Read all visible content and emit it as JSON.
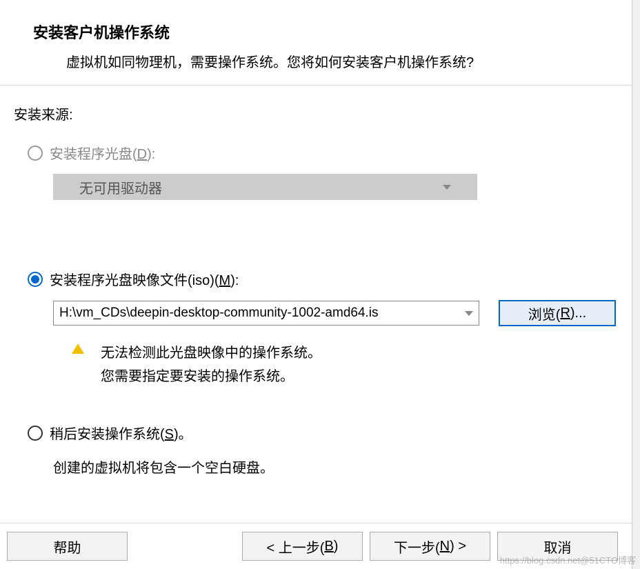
{
  "header": {
    "title": "安装客户机操作系统",
    "description": "虚拟机如同物理机，需要操作系统。您将如何安装客户机操作系统?"
  },
  "source": {
    "label": "安装来源:",
    "opt_disc": {
      "prefix": "安装程序光盘(",
      "accel": "D",
      "suffix": "):",
      "drive_text": "无可用驱动器"
    },
    "opt_iso": {
      "prefix": "安装程序光盘映像文件(iso)(",
      "accel": "M",
      "suffix": "):",
      "path": "H:\\vm_CDs\\deepin-desktop-community-1002-amd64.is",
      "browse_prefix": "浏览(",
      "browse_accel": "R",
      "browse_suffix": ")...",
      "warn_line1": "无法检测此光盘映像中的操作系统。",
      "warn_line2": "您需要指定要安装的操作系统。"
    },
    "opt_later": {
      "prefix": "稍后安装操作系统(",
      "accel": "S",
      "suffix": ")。",
      "desc": "创建的虚拟机将包含一个空白硬盘。"
    }
  },
  "footer": {
    "help": "帮助",
    "back_prefix": "< 上一步(",
    "back_accel": "B",
    "back_suffix": ")",
    "next_prefix": "下一步(",
    "next_accel": "N",
    "next_suffix": ") >",
    "cancel": "取消"
  },
  "watermark": "https://blog.csdn.net@51CTO博客"
}
